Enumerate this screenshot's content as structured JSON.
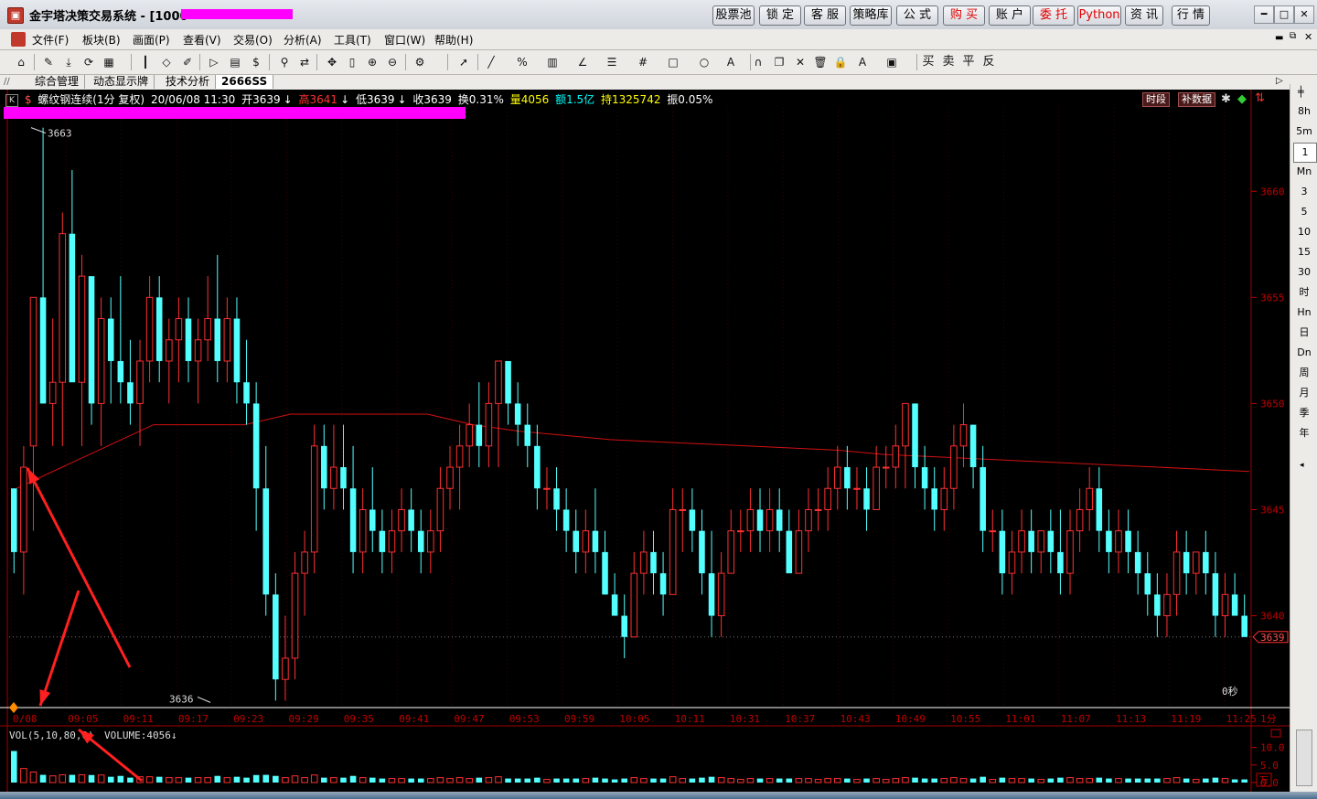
{
  "window": {
    "title": "金宇塔决策交易系统 - [1000",
    "buttons": [
      {
        "label": "股票池",
        "red": false
      },
      {
        "label": "锁 定",
        "red": false
      },
      {
        "label": "客 服",
        "red": false
      },
      {
        "label": "策略库",
        "red": false
      },
      {
        "label": "公 式",
        "red": false
      },
      {
        "label": "购 买",
        "red": true
      },
      {
        "label": "账 户",
        "red": false
      },
      {
        "label": "委 托",
        "red": true
      },
      {
        "label": "Python",
        "red": true
      },
      {
        "label": "资 讯",
        "red": false
      },
      {
        "label": "行 情",
        "red": false
      }
    ]
  },
  "menu": [
    "文件(F)",
    "板块(B)",
    "画面(P)",
    "查看(V)",
    "交易(O)",
    "分析(A)",
    "工具(T)",
    "窗口(W)",
    "帮助(H)"
  ],
  "toolbar_icons": [
    "home-icon",
    "draw-icon",
    "download-icon",
    "refresh-icon",
    "grid-icon",
    "candle-icon",
    "diamond-icon",
    "edit-icon",
    "play-icon",
    "doc-icon",
    "dollar-icon",
    "filter-icon",
    "sync-icon",
    "move-icon",
    "ruler-icon",
    "zoom-in-icon",
    "zoom-out-icon",
    "gear-icon",
    "pointer-icon",
    "line-icon",
    "percent-icon",
    "channel-icon",
    "angle-icon",
    "bars-icon",
    "hash-icon",
    "rect-icon",
    "circle-icon",
    "text-icon",
    "magnet-icon",
    "copy-icon",
    "close-icon",
    "trash-icon",
    "lock-icon",
    "color-icon",
    "save-icon"
  ],
  "toolbar_text_buttons": [
    "买",
    "卖",
    "平",
    "反"
  ],
  "tabs": [
    "综合管理",
    "动态显示牌",
    "技术分析",
    "2666SS"
  ],
  "info": {
    "name": "螺纹钢连续(1分 复权)",
    "datetime": "20/06/08 11:30",
    "open": "开3639",
    "high": "高3641",
    "low": "低3639",
    "close": "收3639",
    "turnover": "换0.31%",
    "volume": "量4056",
    "amount": "额1.5亿",
    "position": "持1325742",
    "amplitude": "振0.05%",
    "btn_period": "时段",
    "btn_fill": "补数据"
  },
  "sidebar_periods": [
    "8h",
    "5m",
    "1",
    "Mn",
    "3",
    "5",
    "10",
    "15",
    "30",
    "时",
    "Hn",
    "日",
    "Dn",
    "周",
    "月",
    "季",
    "年"
  ],
  "chart_data": {
    "type": "candlestick",
    "price_axis": {
      "ticks": [
        3660,
        3655,
        3650,
        3645,
        3640
      ],
      "ylim": [
        3635.5,
        3663.5
      ]
    },
    "time_labels": [
      "0/08",
      "09:05",
      "09:11",
      "09:17",
      "09:23",
      "09:29",
      "09:35",
      "09:41",
      "09:47",
      "09:53",
      "09:59",
      "10:05",
      "10:11",
      "10:31",
      "10:37",
      "10:43",
      "10:49",
      "10:55",
      "11:01",
      "11:07",
      "11:13",
      "11:19",
      "11:25"
    ],
    "period_label": "1分",
    "countdown": "0秒",
    "max_label": "3663",
    "min_label": "3636",
    "last_price": "3639",
    "candles": [
      [
        3646,
        3646,
        3642,
        3643
      ],
      [
        3643,
        3648,
        3641,
        3647
      ],
      [
        3648,
        3655,
        3644,
        3655
      ],
      [
        3655,
        3663,
        3650,
        3650
      ],
      [
        3650,
        3654,
        3648,
        3651
      ],
      [
        3651,
        3659,
        3648,
        3658
      ],
      [
        3658,
        3661,
        3651,
        3651
      ],
      [
        3651,
        3657,
        3648,
        3656
      ],
      [
        3656,
        3656,
        3649,
        3650
      ],
      [
        3650,
        3655,
        3648,
        3654
      ],
      [
        3654,
        3655,
        3650,
        3652
      ],
      [
        3652,
        3656,
        3650,
        3651
      ],
      [
        3651,
        3653,
        3649,
        3650
      ],
      [
        3650,
        3653,
        3648,
        3652
      ],
      [
        3652,
        3656,
        3651,
        3655
      ],
      [
        3655,
        3656,
        3651,
        3652
      ],
      [
        3652,
        3654,
        3650,
        3653
      ],
      [
        3653,
        3655,
        3651,
        3654
      ],
      [
        3654,
        3655,
        3651,
        3652
      ],
      [
        3652,
        3654,
        3650,
        3653
      ],
      [
        3653,
        3656,
        3652,
        3654
      ],
      [
        3654,
        3657,
        3651,
        3652
      ],
      [
        3652,
        3655,
        3651,
        3654
      ],
      [
        3654,
        3655,
        3650,
        3651
      ],
      [
        3651,
        3653,
        3649,
        3650
      ],
      [
        3650,
        3651,
        3644,
        3646
      ],
      [
        3646,
        3648,
        3640,
        3641
      ],
      [
        3641,
        3642,
        3636,
        3637
      ],
      [
        3637,
        3640,
        3636,
        3638
      ],
      [
        3638,
        3643,
        3637,
        3642
      ],
      [
        3642,
        3644,
        3640,
        3643
      ],
      [
        3643,
        3649,
        3642,
        3648
      ],
      [
        3648,
        3649,
        3645,
        3646
      ],
      [
        3646,
        3649,
        3645,
        3647
      ],
      [
        3647,
        3649,
        3645,
        3646
      ],
      [
        3646,
        3648,
        3642,
        3643
      ],
      [
        3643,
        3646,
        3642,
        3645
      ],
      [
        3645,
        3647,
        3643,
        3644
      ],
      [
        3644,
        3645,
        3642,
        3643
      ],
      [
        3643,
        3645,
        3642,
        3644
      ],
      [
        3644,
        3646,
        3643,
        3645
      ],
      [
        3645,
        3646,
        3643,
        3644
      ],
      [
        3644,
        3645,
        3642,
        3643
      ],
      [
        3643,
        3645,
        3642,
        3644
      ],
      [
        3644,
        3647,
        3643,
        3646
      ],
      [
        3646,
        3648,
        3645,
        3647
      ],
      [
        3647,
        3649,
        3645,
        3648
      ],
      [
        3648,
        3650,
        3647,
        3649
      ],
      [
        3649,
        3651,
        3647,
        3648
      ],
      [
        3648,
        3651,
        3647,
        3650
      ],
      [
        3650,
        3652,
        3647,
        3652
      ],
      [
        3652,
        3652,
        3649,
        3650
      ],
      [
        3650,
        3651,
        3648,
        3649
      ],
      [
        3649,
        3650,
        3647,
        3648
      ],
      [
        3648,
        3649,
        3645,
        3646
      ],
      [
        3646,
        3647,
        3645,
        3646
      ],
      [
        3646,
        3647,
        3644,
        3645
      ],
      [
        3645,
        3646,
        3643,
        3644
      ],
      [
        3644,
        3645,
        3642,
        3643
      ],
      [
        3643,
        3645,
        3642,
        3644
      ],
      [
        3644,
        3646,
        3642,
        3643
      ],
      [
        3643,
        3644,
        3641,
        3641
      ],
      [
        3641,
        3642,
        3640,
        3640
      ],
      [
        3640,
        3641,
        3638,
        3639
      ],
      [
        3639,
        3643,
        3639,
        3642
      ],
      [
        3642,
        3644,
        3641,
        3643
      ],
      [
        3643,
        3644,
        3641,
        3642
      ],
      [
        3642,
        3643,
        3640,
        3641
      ],
      [
        3641,
        3646,
        3641,
        3645
      ],
      [
        3645,
        3646,
        3643,
        3645
      ],
      [
        3645,
        3646,
        3643,
        3644
      ],
      [
        3644,
        3645,
        3641,
        3642
      ],
      [
        3642,
        3644,
        3639,
        3640
      ],
      [
        3640,
        3643,
        3639,
        3642
      ],
      [
        3642,
        3645,
        3642,
        3644
      ],
      [
        3644,
        3645,
        3643,
        3644
      ],
      [
        3644,
        3646,
        3643,
        3645
      ],
      [
        3645,
        3646,
        3643,
        3644
      ],
      [
        3644,
        3646,
        3643,
        3645
      ],
      [
        3645,
        3646,
        3643,
        3644
      ],
      [
        3644,
        3645,
        3642,
        3642
      ],
      [
        3642,
        3645,
        3642,
        3644
      ],
      [
        3644,
        3646,
        3643,
        3645
      ],
      [
        3645,
        3646,
        3644,
        3645
      ],
      [
        3645,
        3647,
        3644,
        3646
      ],
      [
        3646,
        3648,
        3645,
        3647
      ],
      [
        3647,
        3648,
        3645,
        3646
      ],
      [
        3646,
        3647,
        3645,
        3646
      ],
      [
        3646,
        3647,
        3644,
        3645
      ],
      [
        3645,
        3648,
        3645,
        3647
      ],
      [
        3647,
        3648,
        3646,
        3647
      ],
      [
        3647,
        3649,
        3646,
        3648
      ],
      [
        3648,
        3650,
        3646,
        3650
      ],
      [
        3650,
        3650,
        3646,
        3647
      ],
      [
        3647,
        3648,
        3645,
        3646
      ],
      [
        3646,
        3647,
        3644,
        3645
      ],
      [
        3645,
        3647,
        3644,
        3646
      ],
      [
        3646,
        3649,
        3645,
        3648
      ],
      [
        3648,
        3650,
        3647,
        3649
      ],
      [
        3649,
        3649,
        3646,
        3647
      ],
      [
        3647,
        3648,
        3643,
        3644
      ],
      [
        3644,
        3645,
        3643,
        3644
      ],
      [
        3644,
        3645,
        3641,
        3642
      ],
      [
        3642,
        3644,
        3641,
        3643
      ],
      [
        3643,
        3645,
        3642,
        3644
      ],
      [
        3644,
        3645,
        3642,
        3643
      ],
      [
        3643,
        3644,
        3642,
        3644
      ],
      [
        3644,
        3645,
        3642,
        3643
      ],
      [
        3643,
        3645,
        3641,
        3642
      ],
      [
        3642,
        3645,
        3641,
        3644
      ],
      [
        3644,
        3646,
        3643,
        3645
      ],
      [
        3645,
        3647,
        3644,
        3646
      ],
      [
        3646,
        3647,
        3643,
        3644
      ],
      [
        3644,
        3645,
        3642,
        3643
      ],
      [
        3643,
        3645,
        3642,
        3644
      ],
      [
        3644,
        3645,
        3642,
        3643
      ],
      [
        3643,
        3644,
        3641,
        3642
      ],
      [
        3642,
        3643,
        3640,
        3641
      ],
      [
        3641,
        3642,
        3639,
        3640
      ],
      [
        3640,
        3642,
        3639,
        3641
      ],
      [
        3641,
        3644,
        3640,
        3643
      ],
      [
        3643,
        3644,
        3641,
        3642
      ],
      [
        3642,
        3643,
        3641,
        3643
      ],
      [
        3643,
        3644,
        3641,
        3642
      ],
      [
        3642,
        3643,
        3639,
        3640
      ],
      [
        3640,
        3642,
        3639,
        3641
      ],
      [
        3641,
        3642,
        3640,
        3640
      ],
      [
        3640,
        3641,
        3639,
        3639
      ]
    ],
    "ma_line": [
      3646,
      3647,
      3648,
      3649,
      3649,
      3649,
      3649.5,
      3649.5,
      3649.5,
      3649.5,
      3649,
      3648.7,
      3648.5,
      3648.3,
      3648.2,
      3648.1,
      3648,
      3647.9,
      3647.8,
      3647.6,
      3647.5,
      3647.4,
      3647.3,
      3647.2,
      3647.1,
      3647.0,
      3646.9,
      3646.8
    ],
    "volume": {
      "label": "VOL(5,10,80,0)",
      "summary": "VOLUME:4056",
      "ticks": [
        "10.0",
        "5.0",
        "0.0"
      ],
      "ylim": [
        0,
        12
      ]
    }
  }
}
